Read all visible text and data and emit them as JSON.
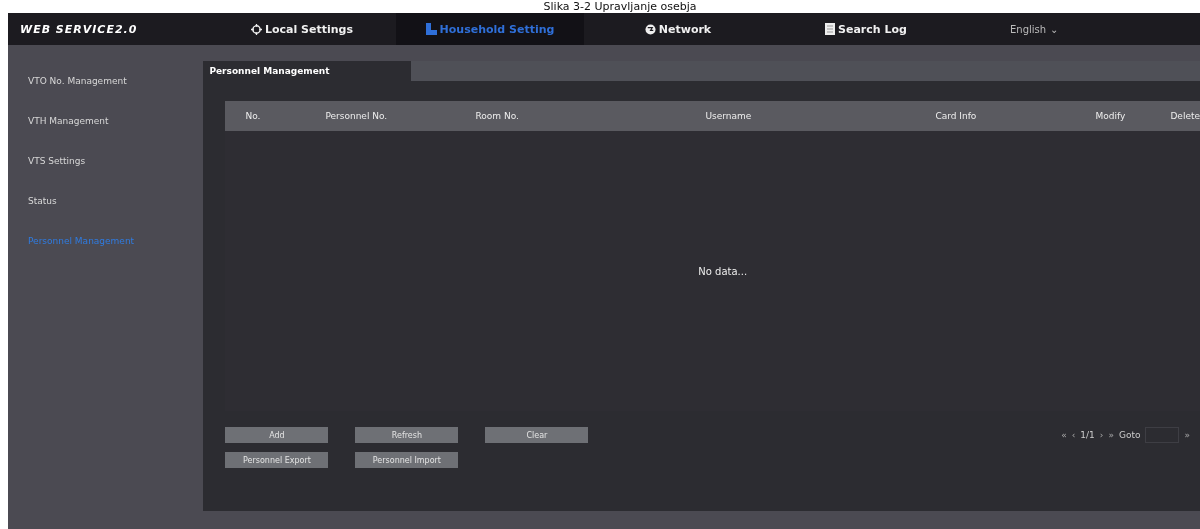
{
  "caption": "Slika 3-2 Upravljanje osebja",
  "brand": "WEB SERVICE2.0",
  "nav": [
    {
      "label": "Local Settings",
      "selected": false
    },
    {
      "label": "Household Setting",
      "selected": true
    },
    {
      "label": "Network",
      "selected": false
    },
    {
      "label": "Search Log",
      "selected": false
    }
  ],
  "language": {
    "label": "English",
    "caret": "⌄"
  },
  "sidebar": {
    "items": [
      {
        "label": "VTO No. Management",
        "selected": false
      },
      {
        "label": "VTH Management",
        "selected": false
      },
      {
        "label": "VTS Settings",
        "selected": false
      },
      {
        "label": "Status",
        "selected": false
      },
      {
        "label": "Personnel Management",
        "selected": true
      }
    ]
  },
  "tabs": [
    {
      "label": "Personnel Management",
      "selected": true
    }
  ],
  "table": {
    "columns": [
      "No.",
      "Personnel No.",
      "Room No.",
      "Username",
      "Card Info",
      "Modify",
      "Delete"
    ],
    "empty_text": "No data..."
  },
  "buttons": [
    [
      "Add",
      "Refresh",
      "Clear"
    ],
    [
      "Personnel Export",
      "Personnel Import"
    ]
  ],
  "pagination": {
    "first": "«",
    "prev": "‹",
    "page": "1/1",
    "next": "›",
    "last": "»",
    "goto_label": "Goto",
    "go": "»"
  }
}
